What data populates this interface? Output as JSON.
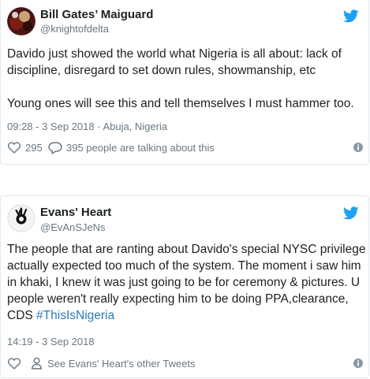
{
  "tweets": [
    {
      "name": "Bill Gates’ Maiguard",
      "handle": "@knightofdelta",
      "paragraphs": [
        "Davido just showed the world what Nigeria is all about: lack of discipline, disregard to set down rules, showmanship, etc",
        "Young ones will see this and tell themselves I must hammer too."
      ],
      "time": "09:28 - 3 Sep 2018",
      "separator": " · ",
      "location": "Abuja, Nigeria",
      "like_count": "295",
      "reply_text": "395 people are talking about this"
    },
    {
      "name": "Evans' Heart",
      "handle": "@EvAnSJeNs",
      "text": "The people that are ranting about Davido's special NYSC privilege actually expected too much of the system. The moment i saw him in khaki, I knew it was just going to be for ceremony & pictures. U people weren't really expecting him to be doing PPA,clearance, CDS ",
      "hashtag": "#ThisIsNigeria",
      "time": "14:19 - 3 Sep 2018",
      "profile_link": "See Evans' Heart's other Tweets"
    }
  ],
  "icons": {
    "logo": "twitter-bird-icon",
    "like": "heart-icon",
    "reply": "speech-bubble-icon",
    "profile": "person-icon",
    "info": "info-icon"
  },
  "colors": {
    "brand": "#1da1f2",
    "link": "#2b7bb9",
    "muted": "#697882",
    "text": "#1c2022"
  }
}
